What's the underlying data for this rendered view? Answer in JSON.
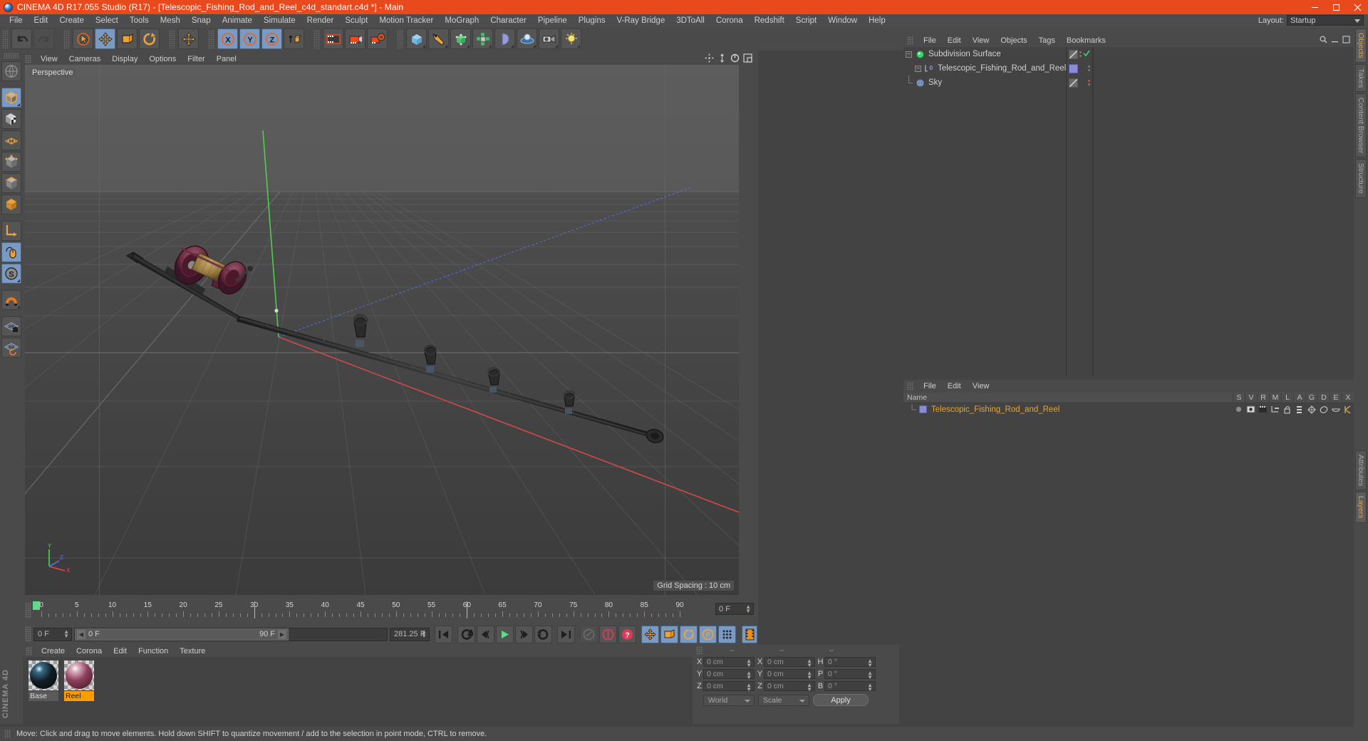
{
  "window": {
    "title": "CINEMA 4D R17.055 Studio (R17) - [Telescopic_Fishing_Rod_and_Reel_c4d_standart.c4d *] - Main",
    "minimize": "—",
    "maximize": "▫",
    "close": "✕"
  },
  "menubar": {
    "items": [
      "File",
      "Edit",
      "Create",
      "Select",
      "Tools",
      "Mesh",
      "Snap",
      "Animate",
      "Simulate",
      "Render",
      "Sculpt",
      "Motion Tracker",
      "MoGraph",
      "Character",
      "Pipeline",
      "Plugins",
      "V-Ray Bridge",
      "3DToAll",
      "Corona",
      "Redshift",
      "Script",
      "Window",
      "Help"
    ],
    "layout_label": "Layout:",
    "layout_value": "Startup"
  },
  "viewport": {
    "menu": [
      "View",
      "Cameras",
      "Display",
      "Options",
      "Filter",
      "Panel"
    ],
    "label": "Perspective",
    "grid_spacing": "Grid Spacing : 10 cm",
    "axis_x": "X",
    "axis_y": "Y",
    "axis_z": "Z"
  },
  "timeline": {
    "ticks": [
      "0",
      "5",
      "10",
      "15",
      "20",
      "25",
      "30",
      "35",
      "40",
      "45",
      "50",
      "55",
      "60",
      "65",
      "70",
      "75",
      "80",
      "85",
      "90"
    ],
    "current_frame_right": "0 F",
    "start_frame": "0 F",
    "range_start": "0 F",
    "range_end": "90 F",
    "fps_field": "281.25 F"
  },
  "materials": {
    "menu": [
      "Create",
      "Corona",
      "Edit",
      "Function",
      "Texture"
    ],
    "items": [
      {
        "name": "Base",
        "selected": false
      },
      {
        "name": "Reel",
        "selected": true
      }
    ]
  },
  "coordinates": {
    "header": [
      "--",
      "--",
      "--"
    ],
    "rows": [
      {
        "l1": "X",
        "v1": "0 cm",
        "l2": "X",
        "v2": "0 cm",
        "l3": "H",
        "v3": "0 °"
      },
      {
        "l1": "Y",
        "v1": "0 cm",
        "l2": "Y",
        "v2": "0 cm",
        "l3": "P",
        "v3": "0 °"
      },
      {
        "l1": "Z",
        "v1": "0 cm",
        "l2": "Z",
        "v2": "0 cm",
        "l3": "B",
        "v3": "0 °"
      }
    ],
    "space": "World",
    "mode": "Scale",
    "apply": "Apply"
  },
  "object_manager": {
    "menu": [
      "File",
      "Edit",
      "View",
      "Objects",
      "Tags",
      "Bookmarks"
    ],
    "rows": [
      {
        "name": "Subdivision Surface",
        "depth": 0,
        "icon": "subdivision-surface-icon",
        "chip": "hatch",
        "check": true
      },
      {
        "name": "Telescopic_Fishing_Rod_and_Reel",
        "depth": 1,
        "icon": "null-object-icon",
        "chip": "purple",
        "check": false
      },
      {
        "name": "Sky",
        "depth": 0,
        "icon": "sky-object-icon",
        "chip": "hatch",
        "dot": "#e04545"
      }
    ]
  },
  "layer_manager": {
    "menu": [
      "File",
      "Edit",
      "View"
    ],
    "columns": [
      "Name",
      "S",
      "V",
      "R",
      "M",
      "L",
      "A",
      "G",
      "D",
      "E",
      "X"
    ],
    "rows": [
      {
        "name": "Telescopic_Fishing_Rod_and_Reel"
      }
    ]
  },
  "right_tabs": {
    "top": [
      "Objects",
      "Takes",
      "Content Browser",
      "Structure"
    ],
    "bottom": [
      "Attributes",
      "Layers"
    ],
    "active_top": "Objects",
    "active_bottom": "Layers"
  },
  "statusbar": {
    "message": "Move: Click and drag to move elements. Hold down SHIFT to quantize movement / add to the selection in point mode, CTRL to remove."
  },
  "branding": {
    "text": "CINEMA 4D"
  },
  "colors": {
    "accent_orange": "#e8491d",
    "selected_blue": "#7a9ac4",
    "panel": "#4a4a4a",
    "body": "#434343",
    "material_selected": "#ff9d00",
    "layer_text": "#e5a43a"
  }
}
